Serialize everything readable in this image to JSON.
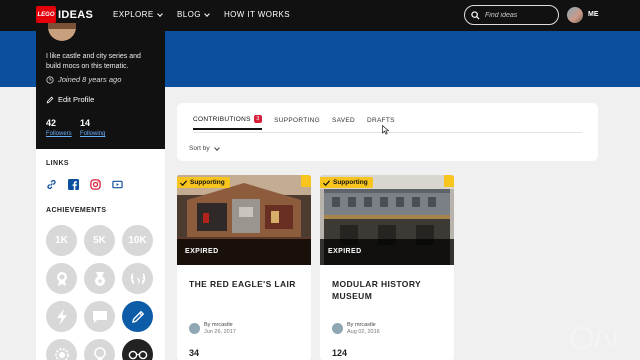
{
  "nav": {
    "logo_badge": "LEGO",
    "logo_text": "IDEAS",
    "explore_label": "EXPLORE",
    "blog_label": "BLOG",
    "how_label": "HOW IT WORKS",
    "search_placeholder": "Find ideas",
    "me_label": "ME"
  },
  "profile": {
    "bio": "I like castle and city series and build mocs on this tematic.",
    "joined": "Joined 8 years ago",
    "edit_label": "Edit Profile",
    "followers_count": "42",
    "followers_label": "Followers",
    "following_count": "14",
    "following_label": "Following"
  },
  "sections": {
    "links_title": "LINKS",
    "achievements_title": "ACHIEVEMENTS"
  },
  "links": [
    "link-icon",
    "facebook-icon",
    "instagram-icon",
    "youtube-icon"
  ],
  "achievements": [
    {
      "label": "1K",
      "icon": "1k-badge-icon"
    },
    {
      "label": "5K",
      "icon": "5k-badge-icon"
    },
    {
      "label": "10K",
      "icon": "10k-badge-icon"
    },
    {
      "label": "",
      "icon": "award-ribbon-icon"
    },
    {
      "label": "",
      "icon": "medal-icon"
    },
    {
      "label": "",
      "icon": "laurel-icon"
    },
    {
      "label": "",
      "icon": "lightning-icon"
    },
    {
      "label": "",
      "icon": "comment-icon"
    },
    {
      "label": "",
      "icon": "pencil-icon"
    },
    {
      "label": "",
      "icon": "gear-badge-icon"
    },
    {
      "label": "",
      "icon": "lightbulb-icon"
    },
    {
      "label": "",
      "icon": "glasses-icon"
    }
  ],
  "tabs": {
    "contributions": "CONTRIBUTIONS",
    "contributions_count": "3",
    "supporting": "SUPPORTING",
    "saved": "SAVED",
    "drafts": "DRAFTS",
    "sort_label": "Sort by"
  },
  "cards": [
    {
      "badge": "Supporting",
      "status": "EXPIRED",
      "title": "THE RED EAGLE'S LAIR",
      "author_prefix": "By",
      "author": "mrcastle",
      "date": "Jun 26, 2017",
      "count": "34"
    },
    {
      "badge": "Supporting",
      "status": "EXPIRED",
      "title": "MODULAR HISTORY MUSEUM",
      "author_prefix": "By",
      "author": "mrcastle",
      "date": "Aug 02, 2016",
      "count": "124"
    }
  ],
  "colors": {
    "nav_bg": "#111111",
    "banner": "#0d4f9f",
    "accent_red": "#d6203a",
    "supporting_yellow": "#f8c51f"
  }
}
